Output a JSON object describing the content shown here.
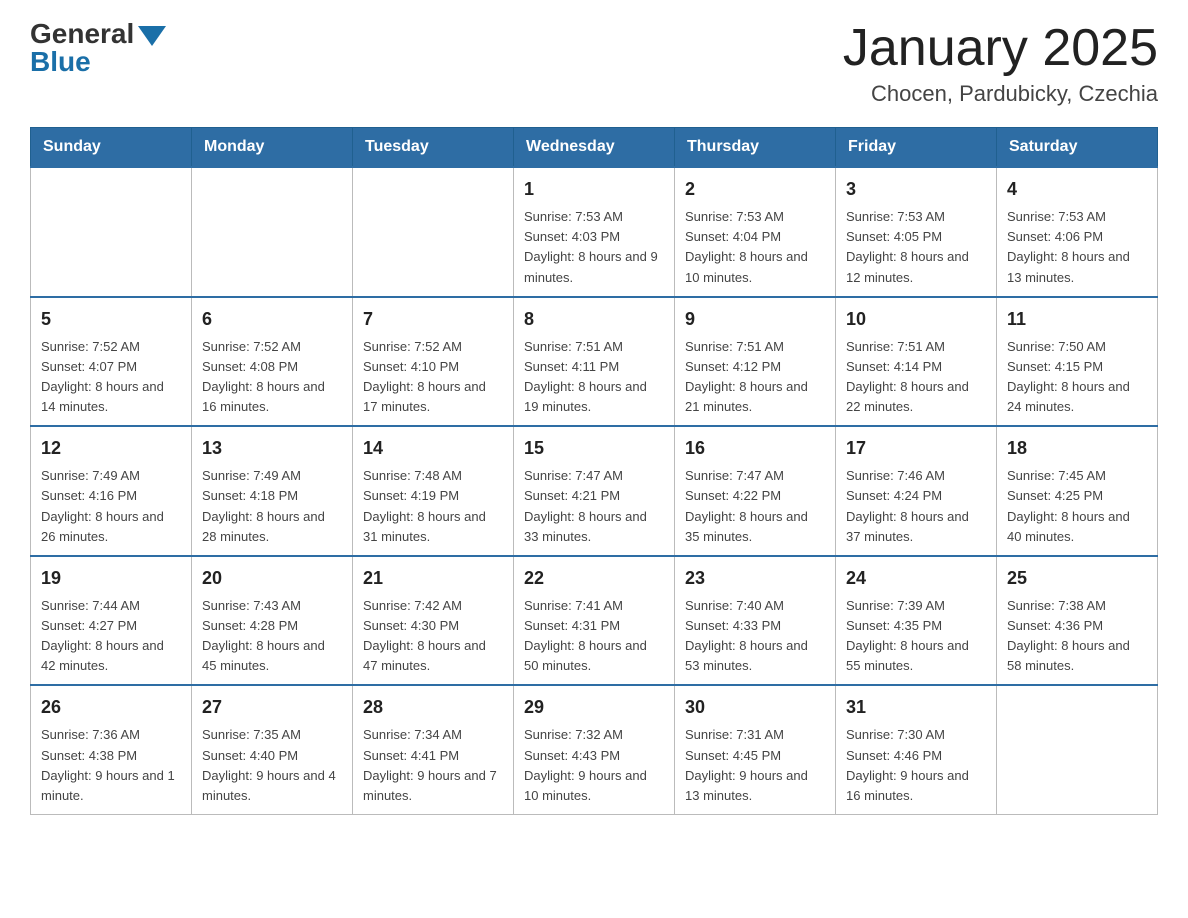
{
  "header": {
    "logo": {
      "general": "General",
      "blue": "Blue"
    },
    "title": "January 2025",
    "subtitle": "Chocen, Pardubicky, Czechia"
  },
  "calendar": {
    "days_of_week": [
      "Sunday",
      "Monday",
      "Tuesday",
      "Wednesday",
      "Thursday",
      "Friday",
      "Saturday"
    ],
    "weeks": [
      {
        "days": [
          {
            "number": "",
            "info": ""
          },
          {
            "number": "",
            "info": ""
          },
          {
            "number": "",
            "info": ""
          },
          {
            "number": "1",
            "info": "Sunrise: 7:53 AM\nSunset: 4:03 PM\nDaylight: 8 hours\nand 9 minutes."
          },
          {
            "number": "2",
            "info": "Sunrise: 7:53 AM\nSunset: 4:04 PM\nDaylight: 8 hours\nand 10 minutes."
          },
          {
            "number": "3",
            "info": "Sunrise: 7:53 AM\nSunset: 4:05 PM\nDaylight: 8 hours\nand 12 minutes."
          },
          {
            "number": "4",
            "info": "Sunrise: 7:53 AM\nSunset: 4:06 PM\nDaylight: 8 hours\nand 13 minutes."
          }
        ]
      },
      {
        "days": [
          {
            "number": "5",
            "info": "Sunrise: 7:52 AM\nSunset: 4:07 PM\nDaylight: 8 hours\nand 14 minutes."
          },
          {
            "number": "6",
            "info": "Sunrise: 7:52 AM\nSunset: 4:08 PM\nDaylight: 8 hours\nand 16 minutes."
          },
          {
            "number": "7",
            "info": "Sunrise: 7:52 AM\nSunset: 4:10 PM\nDaylight: 8 hours\nand 17 minutes."
          },
          {
            "number": "8",
            "info": "Sunrise: 7:51 AM\nSunset: 4:11 PM\nDaylight: 8 hours\nand 19 minutes."
          },
          {
            "number": "9",
            "info": "Sunrise: 7:51 AM\nSunset: 4:12 PM\nDaylight: 8 hours\nand 21 minutes."
          },
          {
            "number": "10",
            "info": "Sunrise: 7:51 AM\nSunset: 4:14 PM\nDaylight: 8 hours\nand 22 minutes."
          },
          {
            "number": "11",
            "info": "Sunrise: 7:50 AM\nSunset: 4:15 PM\nDaylight: 8 hours\nand 24 minutes."
          }
        ]
      },
      {
        "days": [
          {
            "number": "12",
            "info": "Sunrise: 7:49 AM\nSunset: 4:16 PM\nDaylight: 8 hours\nand 26 minutes."
          },
          {
            "number": "13",
            "info": "Sunrise: 7:49 AM\nSunset: 4:18 PM\nDaylight: 8 hours\nand 28 minutes."
          },
          {
            "number": "14",
            "info": "Sunrise: 7:48 AM\nSunset: 4:19 PM\nDaylight: 8 hours\nand 31 minutes."
          },
          {
            "number": "15",
            "info": "Sunrise: 7:47 AM\nSunset: 4:21 PM\nDaylight: 8 hours\nand 33 minutes."
          },
          {
            "number": "16",
            "info": "Sunrise: 7:47 AM\nSunset: 4:22 PM\nDaylight: 8 hours\nand 35 minutes."
          },
          {
            "number": "17",
            "info": "Sunrise: 7:46 AM\nSunset: 4:24 PM\nDaylight: 8 hours\nand 37 minutes."
          },
          {
            "number": "18",
            "info": "Sunrise: 7:45 AM\nSunset: 4:25 PM\nDaylight: 8 hours\nand 40 minutes."
          }
        ]
      },
      {
        "days": [
          {
            "number": "19",
            "info": "Sunrise: 7:44 AM\nSunset: 4:27 PM\nDaylight: 8 hours\nand 42 minutes."
          },
          {
            "number": "20",
            "info": "Sunrise: 7:43 AM\nSunset: 4:28 PM\nDaylight: 8 hours\nand 45 minutes."
          },
          {
            "number": "21",
            "info": "Sunrise: 7:42 AM\nSunset: 4:30 PM\nDaylight: 8 hours\nand 47 minutes."
          },
          {
            "number": "22",
            "info": "Sunrise: 7:41 AM\nSunset: 4:31 PM\nDaylight: 8 hours\nand 50 minutes."
          },
          {
            "number": "23",
            "info": "Sunrise: 7:40 AM\nSunset: 4:33 PM\nDaylight: 8 hours\nand 53 minutes."
          },
          {
            "number": "24",
            "info": "Sunrise: 7:39 AM\nSunset: 4:35 PM\nDaylight: 8 hours\nand 55 minutes."
          },
          {
            "number": "25",
            "info": "Sunrise: 7:38 AM\nSunset: 4:36 PM\nDaylight: 8 hours\nand 58 minutes."
          }
        ]
      },
      {
        "days": [
          {
            "number": "26",
            "info": "Sunrise: 7:36 AM\nSunset: 4:38 PM\nDaylight: 9 hours\nand 1 minute."
          },
          {
            "number": "27",
            "info": "Sunrise: 7:35 AM\nSunset: 4:40 PM\nDaylight: 9 hours\nand 4 minutes."
          },
          {
            "number": "28",
            "info": "Sunrise: 7:34 AM\nSunset: 4:41 PM\nDaylight: 9 hours\nand 7 minutes."
          },
          {
            "number": "29",
            "info": "Sunrise: 7:32 AM\nSunset: 4:43 PM\nDaylight: 9 hours\nand 10 minutes."
          },
          {
            "number": "30",
            "info": "Sunrise: 7:31 AM\nSunset: 4:45 PM\nDaylight: 9 hours\nand 13 minutes."
          },
          {
            "number": "31",
            "info": "Sunrise: 7:30 AM\nSunset: 4:46 PM\nDaylight: 9 hours\nand 16 minutes."
          },
          {
            "number": "",
            "info": ""
          }
        ]
      }
    ]
  }
}
